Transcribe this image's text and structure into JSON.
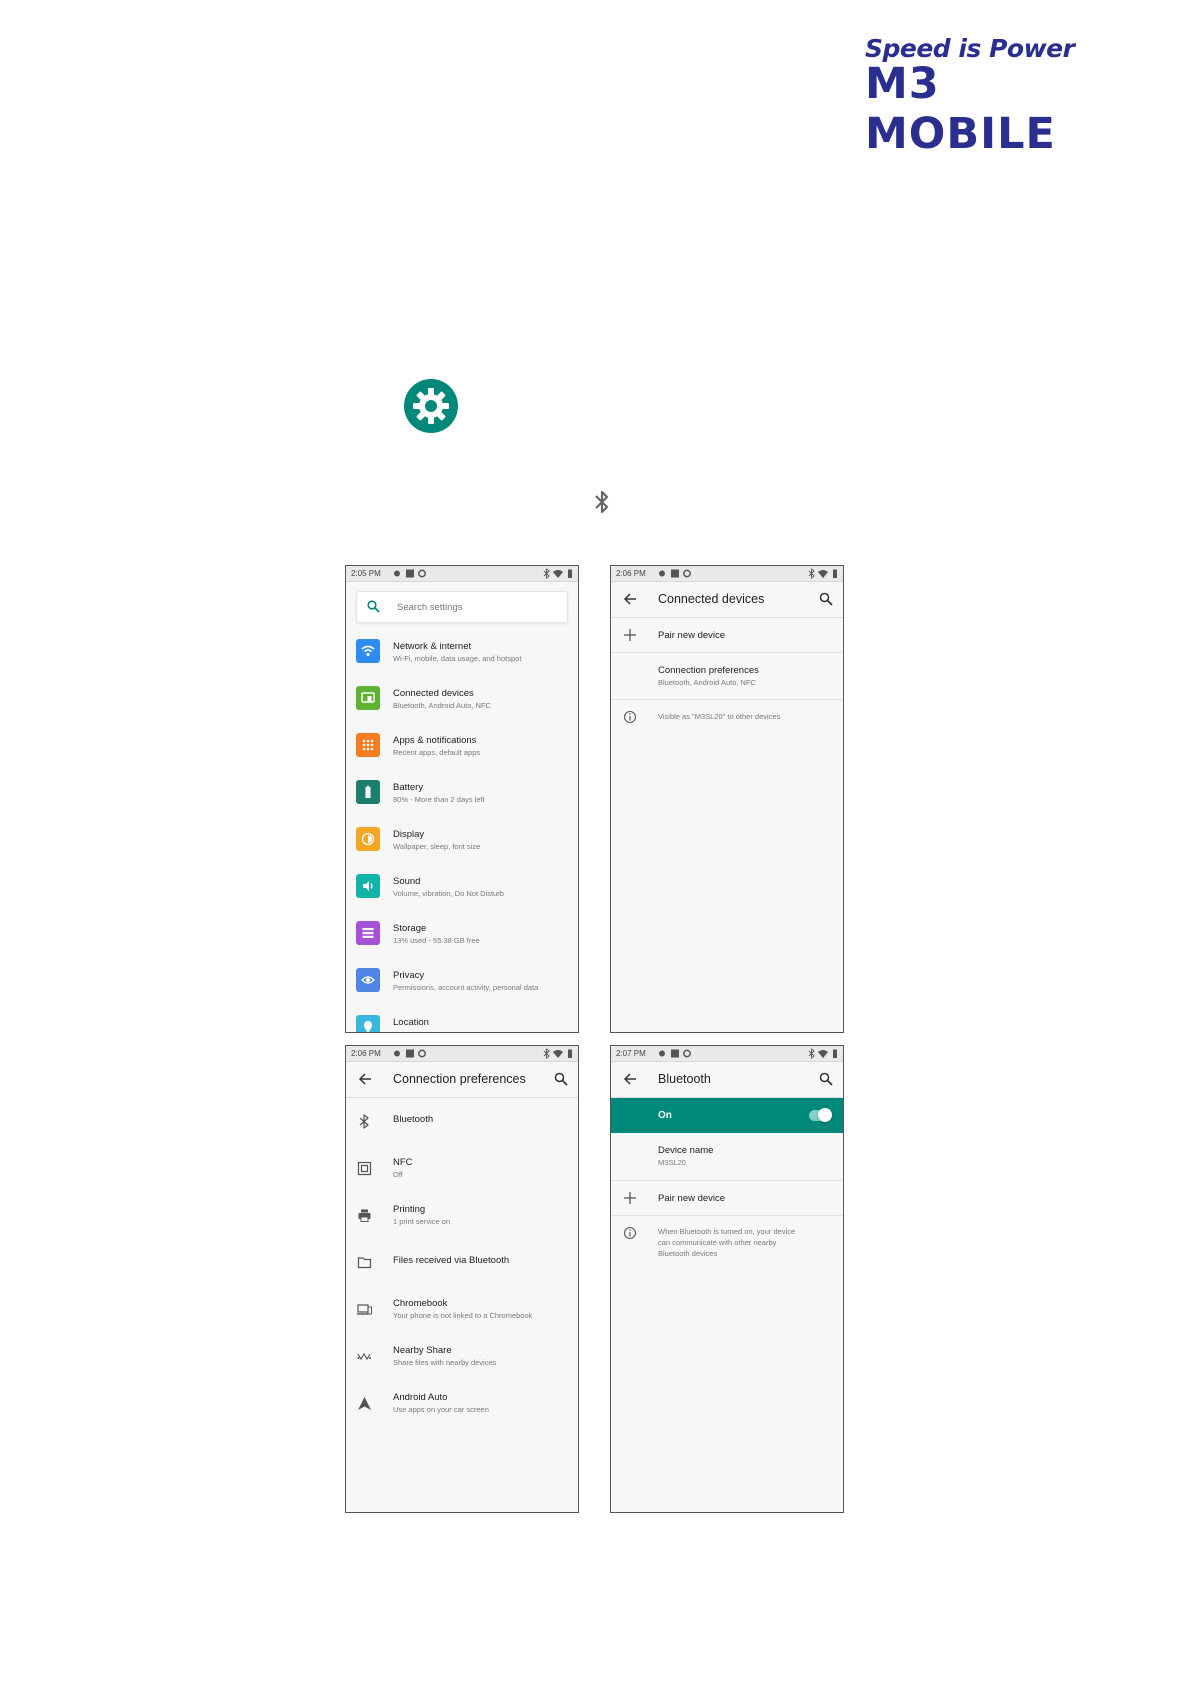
{
  "logo": {
    "tagline": "Speed is Power",
    "brand": "M3 MOBILE"
  },
  "phone1": {
    "time": "2:05 PM",
    "search_placeholder": "Search settings",
    "items": [
      {
        "title": "Network & internet",
        "subtitle": "Wi-Fi, mobile, data usage, and hotspot",
        "color": "#2d8cf0",
        "icon": "wifi-icon"
      },
      {
        "title": "Connected devices",
        "subtitle": "Bluetooth, Android Auto, NFC",
        "color": "#5fb233",
        "icon": "connected-devices-icon"
      },
      {
        "title": "Apps & notifications",
        "subtitle": "Recent apps, default apps",
        "color": "#f57c1f",
        "icon": "apps-grid-icon"
      },
      {
        "title": "Battery",
        "subtitle": "80% - More than 2 days left",
        "color": "#1a7f6e",
        "icon": "battery-icon"
      },
      {
        "title": "Display",
        "subtitle": "Wallpaper, sleep, font size",
        "color": "#f4a623",
        "icon": "brightness-icon"
      },
      {
        "title": "Sound",
        "subtitle": "Volume, vibration, Do Not Disturb",
        "color": "#14b3a8",
        "icon": "volume-icon"
      },
      {
        "title": "Storage",
        "subtitle": "13% used - 55.38 GB free",
        "color": "#a552d9",
        "icon": "storage-icon"
      },
      {
        "title": "Privacy",
        "subtitle": "Permissions, account activity, personal data",
        "color": "#4f86e6",
        "icon": "privacy-eye-icon"
      },
      {
        "title": "Location",
        "subtitle": "",
        "color": "#37b8dc",
        "icon": "location-icon"
      }
    ]
  },
  "phone2": {
    "time": "2:06 PM",
    "title": "Connected devices",
    "pair_new": "Pair new device",
    "pref_title": "Connection preferences",
    "pref_subtitle": "Bluetooth, Android Auto, NFC",
    "visible_as": "Visible as \"M3SL20\" to other devices"
  },
  "phone3": {
    "time": "2:06 PM",
    "title": "Connection preferences",
    "items": [
      {
        "title": "Bluetooth",
        "subtitle": "",
        "icon": "bluetooth-icon"
      },
      {
        "title": "NFC",
        "subtitle": "Off",
        "icon": "nfc-icon"
      },
      {
        "title": "Printing",
        "subtitle": "1 print service on",
        "icon": "printer-icon"
      },
      {
        "title": "Files received via Bluetooth",
        "subtitle": "",
        "icon": "folder-icon"
      },
      {
        "title": "Chromebook",
        "subtitle": "Your phone is not linked to a Chromebook",
        "icon": "chromebook-icon"
      },
      {
        "title": "Nearby Share",
        "subtitle": "Share files with nearby devices",
        "icon": "nearby-share-icon"
      },
      {
        "title": "Android Auto",
        "subtitle": "Use apps on your car screen",
        "icon": "android-auto-icon"
      }
    ]
  },
  "phone4": {
    "time": "2:07 PM",
    "title": "Bluetooth",
    "on_label": "On",
    "toggle_on": true,
    "device_name_label": "Device name",
    "device_name_value": "M3SL20",
    "pair_new": "Pair new device",
    "info_line1": "When Bluetooth is turned on, your device",
    "info_line2": "can communicate with other nearby",
    "info_line3": "Bluetooth devices"
  },
  "colors": {
    "teal": "#00897b",
    "brand_blue": "#2a2f8f"
  }
}
